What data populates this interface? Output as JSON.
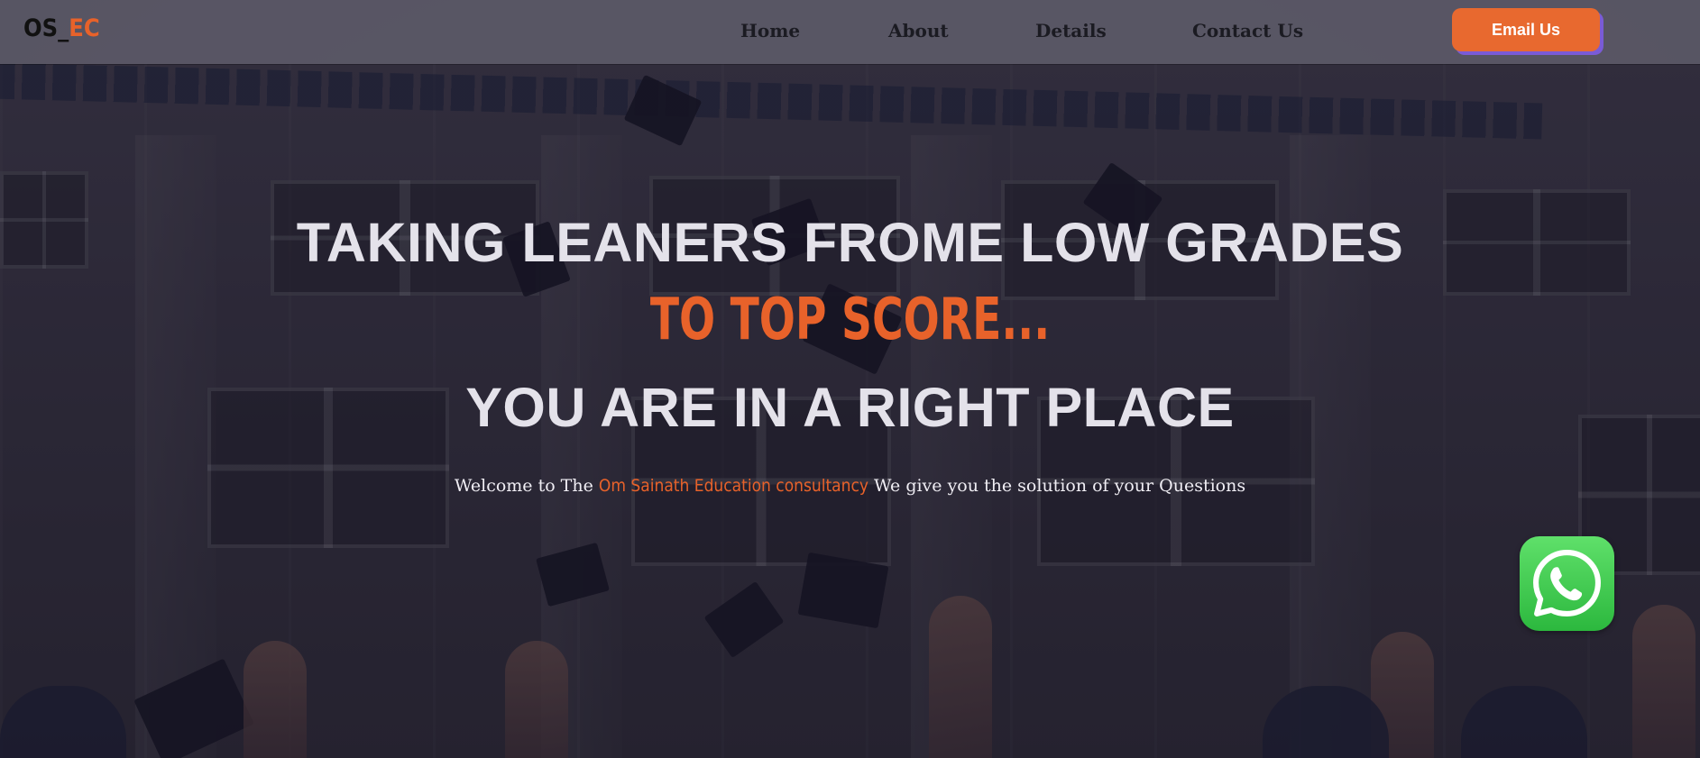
{
  "logo": {
    "prefix": "OS_",
    "accent": "EC"
  },
  "nav": {
    "items": [
      {
        "label": "Home"
      },
      {
        "label": "About"
      },
      {
        "label": "Details"
      },
      {
        "label": "Contact Us"
      }
    ],
    "cta_label": "Email Us"
  },
  "hero": {
    "line1": "TAKING LEANERS FROME LOW GRADES",
    "line2": "TO TOP SCORE...",
    "line3": "YOU ARE IN A RIGHT PLACE",
    "welcome_before": "Welcome to The ",
    "welcome_highlight": "Om Sainath Education consultancy",
    "welcome_after": " We give you the solution of your Questions"
  },
  "floating": {
    "icon": "whatsapp-icon"
  },
  "colors": {
    "accent": "#e8622a",
    "button": "#e8692f",
    "button_shadow": "#7a5bd6",
    "whatsapp": "#2cb83e",
    "header_bg": "#5c5a68"
  }
}
